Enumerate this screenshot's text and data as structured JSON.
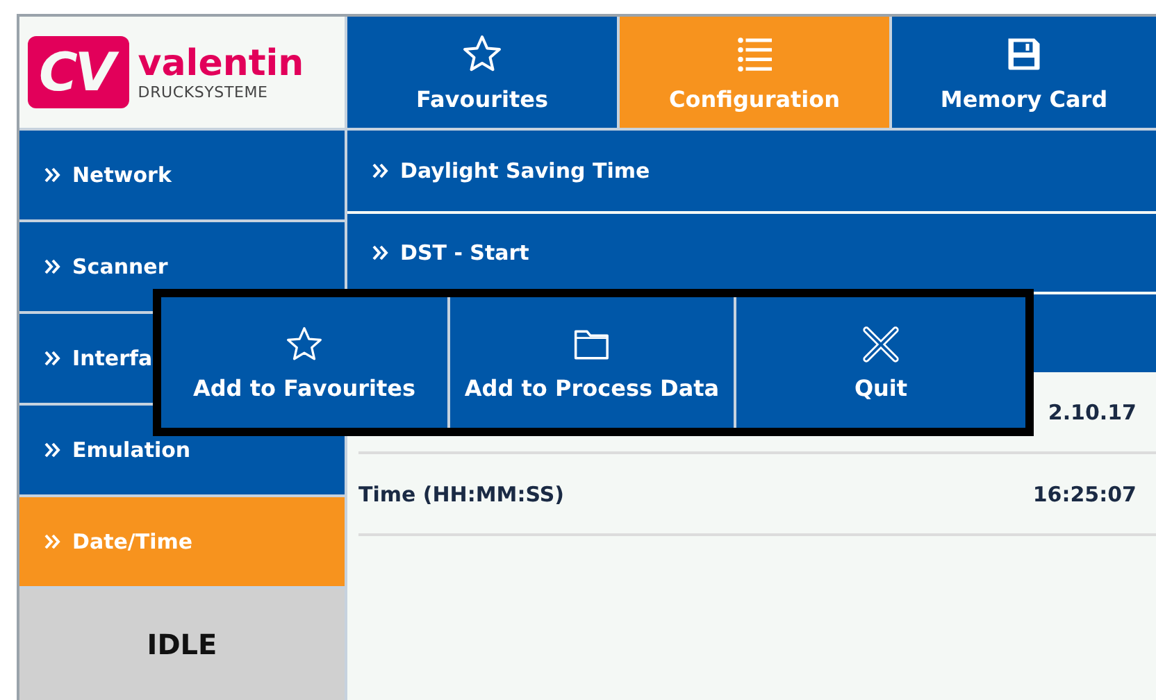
{
  "logo": {
    "mark": "CV",
    "name": "valentin",
    "subtitle": "DRUCKSYSTEME"
  },
  "tabs": [
    {
      "label": "Favourites",
      "selected": false
    },
    {
      "label": "Configuration",
      "selected": true
    },
    {
      "label": "Memory Card",
      "selected": false
    }
  ],
  "sidebar": {
    "items": [
      {
        "label": "Network",
        "selected": false
      },
      {
        "label": "Scanner",
        "selected": false
      },
      {
        "label": "Interfa",
        "selected": false
      },
      {
        "label": "Emulation",
        "selected": false
      },
      {
        "label": "Date/Time",
        "selected": true
      }
    ],
    "status": "IDLE"
  },
  "settings": [
    {
      "kind": "group",
      "label": "Daylight Saving Time"
    },
    {
      "kind": "group",
      "label": "DST - Start"
    },
    {
      "kind": "group"
    },
    {
      "kind": "value",
      "value": "2.10.17"
    },
    {
      "kind": "value",
      "label": "Time (HH:MM:SS)",
      "value": "16:25:07"
    }
  ],
  "popup": {
    "buttons": [
      {
        "label": "Add to Favourites"
      },
      {
        "label": "Add to Process Data"
      },
      {
        "label": "Quit"
      }
    ]
  }
}
